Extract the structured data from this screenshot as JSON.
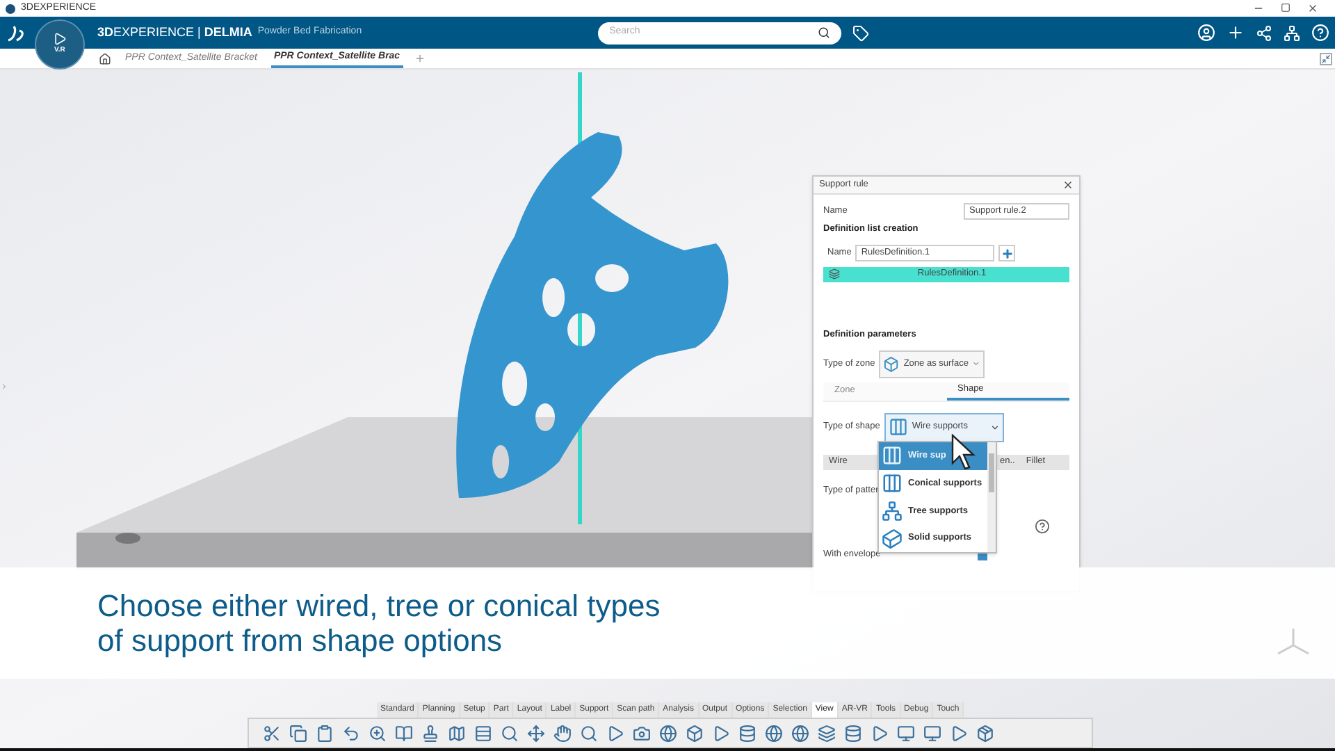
{
  "titlebar": {
    "title": "3DEXPERIENCE"
  },
  "header": {
    "brand": "**3D**EXPERIENCE | **DELMIA**",
    "app": "Powder Bed Fabrication",
    "compass_label": "V.R",
    "search": {
      "placeholder": "Search"
    }
  },
  "tabs": [
    {
      "label": "PPR Context_Satellite Bracket",
      "selected": false
    },
    {
      "label": "PPR Context_Satellite Brac",
      "selected": true
    }
  ],
  "dialog": {
    "title": "Support rule",
    "name_label": "Name",
    "name_value": "Support rule.2",
    "list_heading": "Definition list creation",
    "list_name_label": "Name",
    "list_name_value": "RulesDefinition.1",
    "list_items": [
      {
        "label": "RulesDefinition.1",
        "selected": true
      }
    ],
    "params_heading": "Definition parameters",
    "zone_label": "Type of zone",
    "zone_value": "Zone as surface",
    "tabs": [
      {
        "label": "Zone",
        "selected": false
      },
      {
        "label": "Shape",
        "selected": true
      }
    ],
    "shape_label": "Type of shape",
    "shape_value": "Wire supports",
    "columns": [
      "Wire",
      "en..",
      "Fillet"
    ],
    "pattern_label": "Type of patter",
    "envelope_label": "With envelope",
    "envelope_checked": true,
    "dropdown": [
      {
        "label": "Wire sup",
        "kind": "wire",
        "selected": true
      },
      {
        "label": "Conical supports",
        "kind": "conical",
        "selected": false
      },
      {
        "label": "Tree supports",
        "kind": "tree",
        "selected": false
      },
      {
        "label": "Solid supports",
        "kind": "solid",
        "selected": false
      }
    ]
  },
  "caption": [
    "Choose either wired, tree or conical types",
    "of support from shape options"
  ],
  "toolbar": {
    "tabs": [
      {
        "label": "Standard",
        "selected": false
      },
      {
        "label": "Planning",
        "selected": false
      },
      {
        "label": "Setup",
        "selected": false
      },
      {
        "label": "Part",
        "selected": false
      },
      {
        "label": "Layout",
        "selected": false
      },
      {
        "label": "Label",
        "selected": false
      },
      {
        "label": "Support",
        "selected": false
      },
      {
        "label": "Scan path",
        "selected": false
      },
      {
        "label": "Analysis",
        "selected": false
      },
      {
        "label": "Output",
        "selected": false
      },
      {
        "label": "Options",
        "selected": false
      },
      {
        "label": "Selection",
        "selected": false
      },
      {
        "label": "View",
        "selected": true
      },
      {
        "label": "AR-VR",
        "selected": false
      },
      {
        "label": "Tools",
        "selected": false
      },
      {
        "label": "Debug",
        "selected": false
      },
      {
        "label": "Touch",
        "selected": false
      }
    ]
  }
}
